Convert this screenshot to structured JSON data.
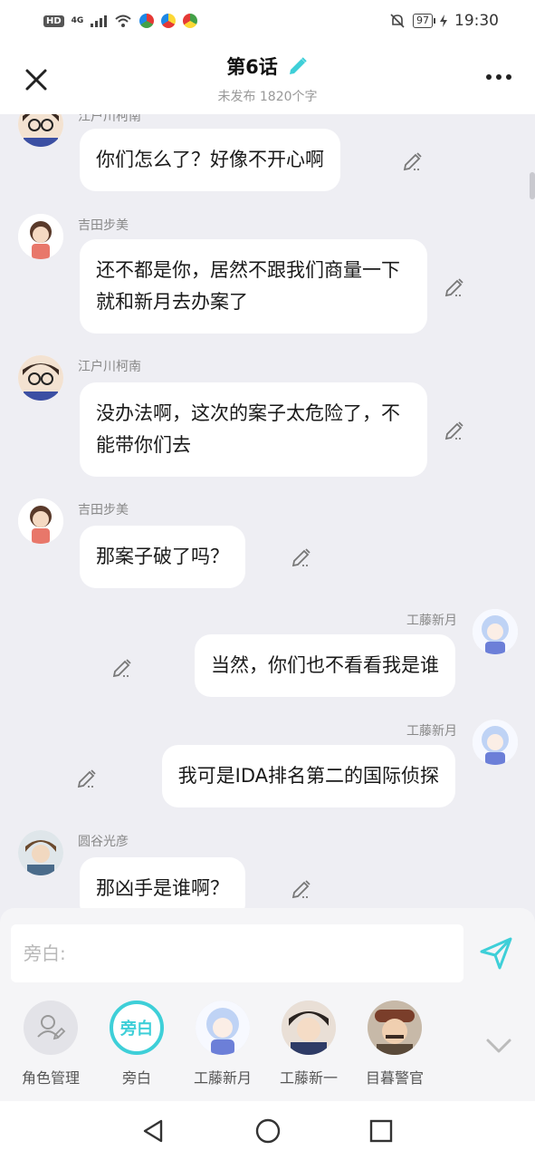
{
  "status_bar": {
    "hd": "HD",
    "network": "4G",
    "battery": "97",
    "time": "19:30"
  },
  "header": {
    "title": "第6话",
    "subtitle": "未发布 1820个字"
  },
  "messages": [
    {
      "sender": "江户川柯南",
      "text": "你们怎么了？好像不开心啊",
      "side": "left",
      "avatar": "conan"
    },
    {
      "sender": "吉田步美",
      "text": "还不都是你，居然不跟我们商量一下就和新月去办案了",
      "side": "left",
      "avatar": "ayumi"
    },
    {
      "sender": "江户川柯南",
      "text": "没办法啊，这次的案子太危险了，不能带你们去",
      "side": "left",
      "avatar": "conan"
    },
    {
      "sender": "吉田步美",
      "text": "那案子破了吗？",
      "side": "left",
      "avatar": "ayumi"
    },
    {
      "sender": "工藤新月",
      "text": "当然，你们也不看看我是谁",
      "side": "right",
      "avatar": "shingetsu"
    },
    {
      "sender": "工藤新月",
      "text": "我可是IDA排名第二的国际侦探",
      "side": "right",
      "avatar": "shingetsu"
    },
    {
      "sender": "圆谷光彦",
      "text": "那凶手是谁啊？",
      "side": "left",
      "avatar": "mitsuhiko"
    }
  ],
  "composer": {
    "placeholder": "旁白:"
  },
  "roles": [
    {
      "label": "角色管理",
      "type": "manage"
    },
    {
      "label": "旁白",
      "type": "narration",
      "badge": "旁白"
    },
    {
      "label": "工藤新月",
      "type": "avatar",
      "avatar": "shingetsu"
    },
    {
      "label": "工藤新一",
      "type": "avatar",
      "avatar": "shinichi"
    },
    {
      "label": "目暮警官",
      "type": "avatar",
      "avatar": "megure"
    }
  ],
  "colors": {
    "accent": "#3ecfd8",
    "background": "#eeeef3",
    "bubble": "#ffffff"
  }
}
